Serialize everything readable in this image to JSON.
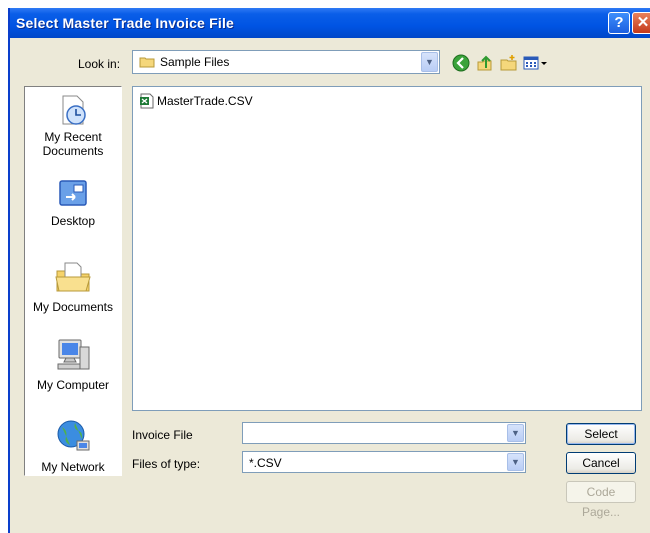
{
  "window": {
    "title": "Select Master Trade Invoice File"
  },
  "lookin": {
    "label": "Look in:",
    "value": "Sample Files"
  },
  "places": [
    {
      "label": "My Recent Documents"
    },
    {
      "label": "Desktop"
    },
    {
      "label": "My Documents"
    },
    {
      "label": "My Computer"
    },
    {
      "label": "My Network"
    }
  ],
  "files": [
    {
      "name": "MasterTrade.CSV",
      "icon": "excel-csv-file-icon"
    }
  ],
  "form": {
    "invoice_label": "Invoice File",
    "invoice_value": "",
    "type_label": "Files of type:",
    "type_value": "*.CSV"
  },
  "buttons": {
    "select": "Select",
    "cancel": "Cancel",
    "code_page": "Code Page..."
  },
  "colors": {
    "titlebar": "#0054e3",
    "dialog": "#ece9d8",
    "close": "#c4391b"
  }
}
